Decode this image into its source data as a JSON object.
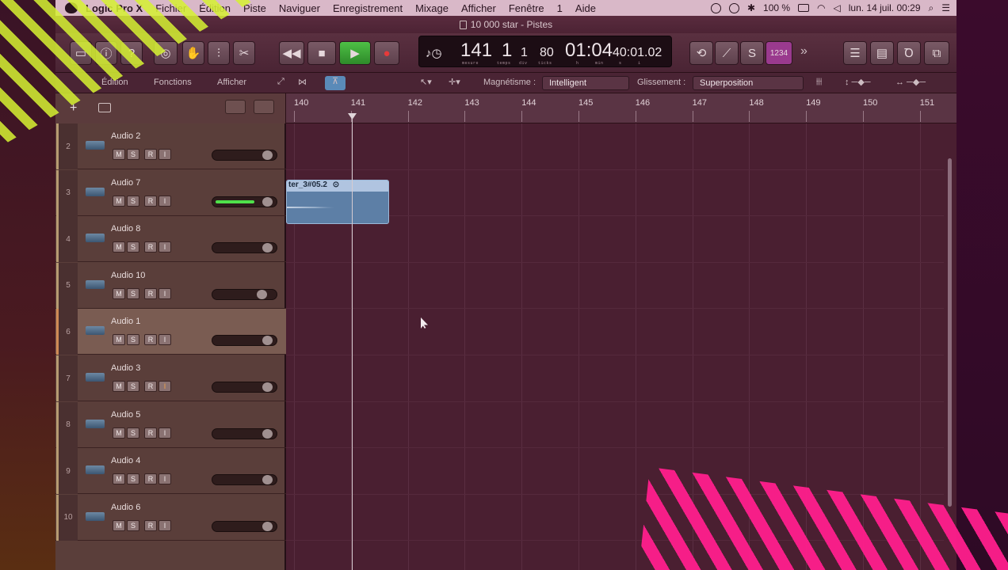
{
  "menubar": {
    "app_name": "Logic Pro X",
    "items": [
      "Fichier",
      "Édition",
      "Piste",
      "Naviguer",
      "Enregistrement",
      "Mixage",
      "Afficher",
      "Fenêtre",
      "1",
      "Aide"
    ],
    "battery": "100 %",
    "datetime": "lun. 14 juil.  00:29"
  },
  "window": {
    "title": "10 000 star - Pistes"
  },
  "lcd": {
    "bar": "141",
    "beat": "1",
    "division": "1",
    "tick": "80",
    "time_main": "01:04",
    "time_fraction": "40:01.02",
    "bar_sub": "mesure",
    "beat_sub": "temps",
    "div_sub": "div",
    "tick_sub": "ticks",
    "time_sub_h": "h",
    "time_sub_min": "min",
    "time_sub_s": "s",
    "time_sub_i": "i",
    "count_in": "1234"
  },
  "subtoolbar": {
    "edit_menu": "Édition",
    "functions_menu": "Fonctions",
    "view_menu": "Afficher",
    "snap_label": "Magnétisme :",
    "snap_value": "Intelligent",
    "drag_label": "Glissement :",
    "drag_value": "Superposition"
  },
  "ruler": {
    "bars": [
      "140",
      "141",
      "142",
      "143",
      "144",
      "145",
      "146",
      "147",
      "148",
      "149",
      "150",
      "151"
    ]
  },
  "tracks": [
    {
      "number": "2",
      "name": "Audio 2",
      "meter": 0,
      "knob": 0.9,
      "rec_on": false,
      "selected": false
    },
    {
      "number": "3",
      "name": "Audio 7",
      "meter": 0.7,
      "knob": 0.9,
      "rec_on": false,
      "selected": false
    },
    {
      "number": "4",
      "name": "Audio 8",
      "meter": 0,
      "knob": 0.9,
      "rec_on": false,
      "selected": false
    },
    {
      "number": "5",
      "name": "Audio 10",
      "meter": 0,
      "knob": 0.8,
      "rec_on": false,
      "selected": false
    },
    {
      "number": "6",
      "name": "Audio 1",
      "meter": 0,
      "knob": 0.9,
      "rec_on": false,
      "selected": true
    },
    {
      "number": "7",
      "name": "Audio 3",
      "meter": 0,
      "knob": 0.9,
      "rec_on": true,
      "selected": false
    },
    {
      "number": "8",
      "name": "Audio 5",
      "meter": 0,
      "knob": 0.9,
      "rec_on": false,
      "selected": false
    },
    {
      "number": "9",
      "name": "Audio 4",
      "meter": 0,
      "knob": 0.9,
      "rec_on": false,
      "selected": false
    },
    {
      "number": "10",
      "name": "Audio 6",
      "meter": 0,
      "knob": 0.9,
      "rec_on": false,
      "selected": false
    }
  ],
  "track_buttons": {
    "mute": "M",
    "solo": "S",
    "record": "R",
    "input": "I"
  },
  "region": {
    "name": "ter_3#05.2"
  },
  "colors": {
    "accent_play": "#3fae3a",
    "record": "#e53a3a",
    "region": "#5d7fa6",
    "stripe_yellow": "#d6f232",
    "stripe_pink": "#ff1e8c"
  }
}
